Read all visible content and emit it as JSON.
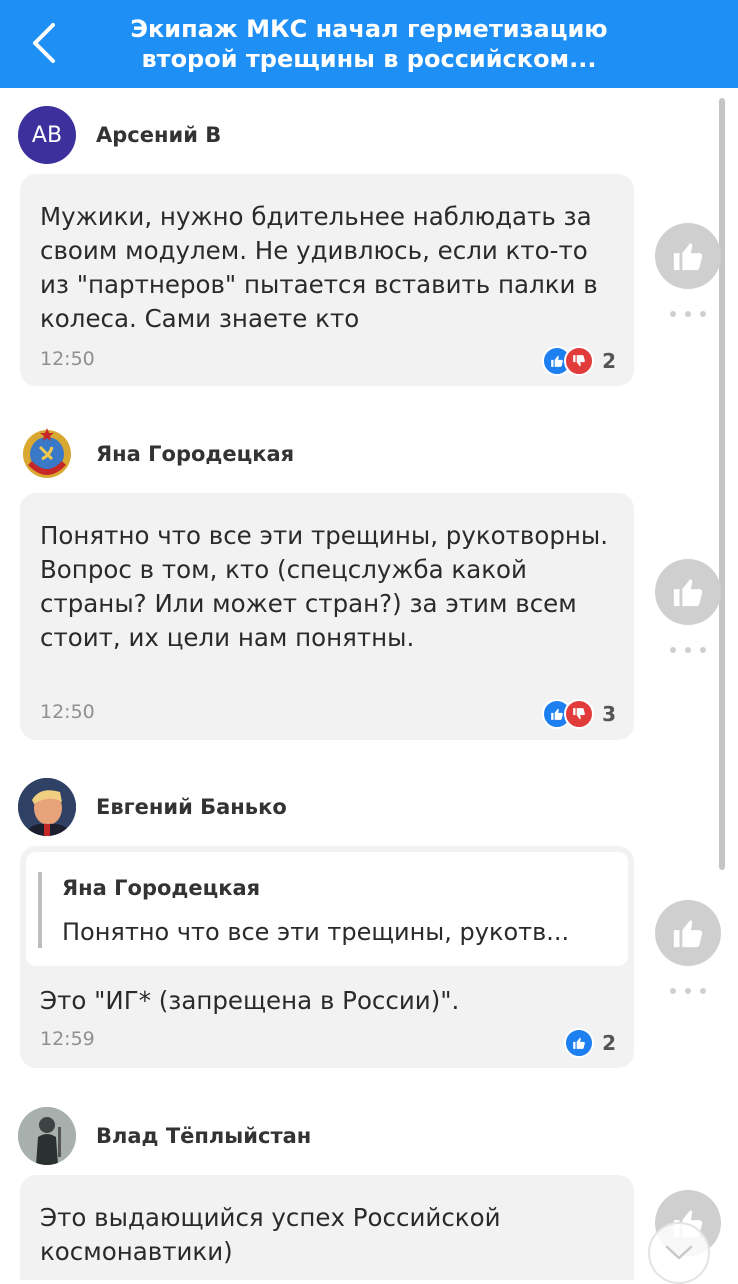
{
  "header": {
    "title": "Экипаж МКС начал герметизацию второй трещины в российском..."
  },
  "comments": [
    {
      "author": "Арсений В",
      "initials": "AB",
      "text": "Мужики, нужно бдительнее наблюдать за своим модулем. Не удивлюсь, если кто-то из \"партнеров\" пытается вставить палки в колеса. Сами знаете кто",
      "time": "12:50",
      "reaction_count": "2"
    },
    {
      "author": "Яна Городецкая",
      "text": "Понятно что все эти трещины, рукотворны. Вопрос в том, кто (спецслужба какой страны? Или может стран?) за этим всем стоит, их цели нам понятны.",
      "time": "12:50",
      "reaction_count": "3"
    },
    {
      "author": "Евгений Банько",
      "quote": {
        "author": "Яна Городецкая",
        "text": "Понятно что все эти трещины, рукотв..."
      },
      "text": "Это \"ИГ* (запрещена в России)\".",
      "time": "12:59",
      "reaction_count": "2"
    },
    {
      "author": "Влад Тёплыйстан",
      "text": "Это выдающийся успех Российской космонавтики)"
    }
  ],
  "colors": {
    "header": "#1e8ff4",
    "like": "#1e7ff0",
    "dislike": "#e23b3b",
    "bubble": "#f2f2f2"
  },
  "icons": [
    "back-arrow-icon",
    "thumbs-up-icon",
    "thumbs-down-icon",
    "more-dots-icon",
    "chevron-down-icon"
  ]
}
